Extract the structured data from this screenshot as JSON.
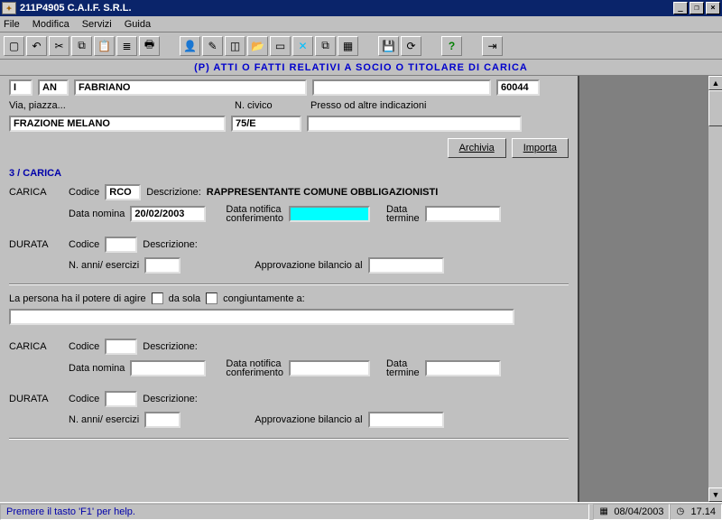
{
  "title": "211P4905 C.A.I.F. S.R.L.",
  "menu": {
    "file": "File",
    "modifica": "Modifica",
    "servizi": "Servizi",
    "guida": "Guida"
  },
  "header_strip": "(P)   ATTI O FATTI RELATIVI A SOCIO O TITOLARE DI CARICA",
  "top": {
    "prov_code": "I",
    "prov": "AN",
    "comune": "FABRIANO",
    "extra": "",
    "cap": "60044",
    "via_label": "Via, piazza...",
    "civico_label": "N. civico",
    "presso_label": "Presso od altre indicazioni",
    "via_value": "FRAZIONE MELANO",
    "civico_value": "75/E",
    "presso_value": "",
    "archivia": "Archivia",
    "importa": "Importa"
  },
  "section_title": "3 / CARICA",
  "carica1": {
    "carica_label": "CARICA",
    "codice_label": "Codice",
    "codice_value": "RCO",
    "descr_label": "Descrizione:",
    "descr_value": "RAPPRESENTANTE COMUNE OBBLIGAZIONISTI",
    "data_nomina_label": "Data nomina",
    "data_nomina_value": "20/02/2003",
    "data_notifica_label1": "Data notifica",
    "data_notifica_label2": "conferimento",
    "data_termine_label1": "Data",
    "data_termine_label2": "termine"
  },
  "durata1": {
    "durata_label": "DURATA",
    "codice_label": "Codice",
    "descr_label": "Descrizione:",
    "anni_label": "N. anni/ esercizi",
    "approv_label": "Approvazione bilancio al"
  },
  "agire": {
    "text": "La persona ha il potere di agire",
    "cb1": "da sola",
    "cb2": "congiuntamente a:"
  },
  "carica2": {
    "carica_label": "CARICA",
    "codice_label": "Codice",
    "descr_label": "Descrizione:",
    "data_nomina_label": "Data nomina",
    "data_notifica_label1": "Data notifica",
    "data_notifica_label2": "conferimento",
    "data_termine_label1": "Data",
    "data_termine_label2": "termine"
  },
  "durata2": {
    "durata_label": "DURATA",
    "codice_label": "Codice",
    "descr_label": "Descrizione:",
    "anni_label": "N. anni/ esercizi",
    "approv_label": "Approvazione bilancio al"
  },
  "status": {
    "help": "Premere il tasto 'F1' per help.",
    "date": "08/04/2003",
    "time": "17.14"
  }
}
